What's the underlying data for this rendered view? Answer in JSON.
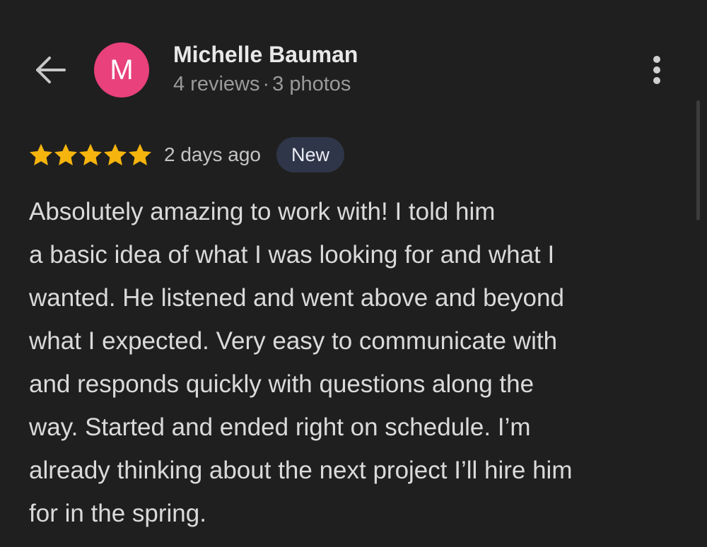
{
  "reviewer": {
    "avatar_letter": "M",
    "name": "Michelle Bauman",
    "reviews": "4 reviews",
    "separator": "·",
    "photos": "3 photos"
  },
  "review": {
    "rating": 5,
    "rating_max": 5,
    "time": "2 days ago",
    "badge": "New",
    "text_lines": [
      "Absolutely amazing to work with! I told him",
      "a basic idea of what I was looking for and what I",
      "wanted. He listened and went above and beyond",
      "what I expected. Very easy to communicate with",
      "and responds quickly with questions along the",
      "way. Started and ended right on schedule. I’m",
      "already thinking about the next project I’ll hire him",
      "for in the spring."
    ]
  },
  "icons": {
    "back": "arrow-left-icon",
    "menu": "more-vertical-icon",
    "star": "star-icon"
  },
  "colors": {
    "background": "#1f1f1f",
    "avatar": "#e8417b",
    "star": "#f6b40e",
    "badge_bg": "#303649"
  }
}
